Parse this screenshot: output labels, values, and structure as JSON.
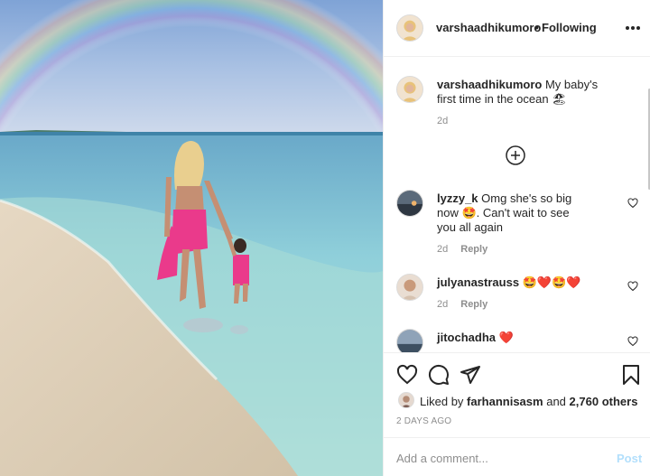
{
  "post": {
    "photo_alt": "",
    "author": {
      "username": "varshaadhikumoro",
      "follow_status": "Following",
      "separator": "•"
    },
    "caption": {
      "username": "varshaadhikumoro",
      "text": "My baby's first time in the ocean 🏖",
      "time": "2d"
    },
    "comments": [
      {
        "username": "lyzzy_k",
        "text": "Omg she's so big now 🤩. Can't wait to see you all again",
        "time": "2d",
        "reply_label": "Reply"
      },
      {
        "username": "julyanastrauss",
        "text": "🤩❤️🤩❤️",
        "time": "2d",
        "reply_label": "Reply"
      },
      {
        "username": "jitochadha",
        "text": "❤️",
        "time": "",
        "reply_label": ""
      }
    ],
    "likes": {
      "prefix": "Liked by",
      "first_liker": "farhannisasm",
      "conjunction": "and",
      "others": "2,760 others"
    },
    "posted_ago": "2 DAYS AGO",
    "composer": {
      "placeholder": "Add a comment...",
      "post_label": "Post"
    }
  },
  "icons": {
    "more": "more-options-icon",
    "load_more": "plus-circle-icon",
    "like": "heart-icon",
    "comment": "comment-icon",
    "share": "paper-plane-icon",
    "save": "bookmark-icon"
  },
  "colors": {
    "text": "#262626",
    "muted": "#8e8e8e",
    "border": "#efefef",
    "post_disabled": "#b2dffc"
  }
}
